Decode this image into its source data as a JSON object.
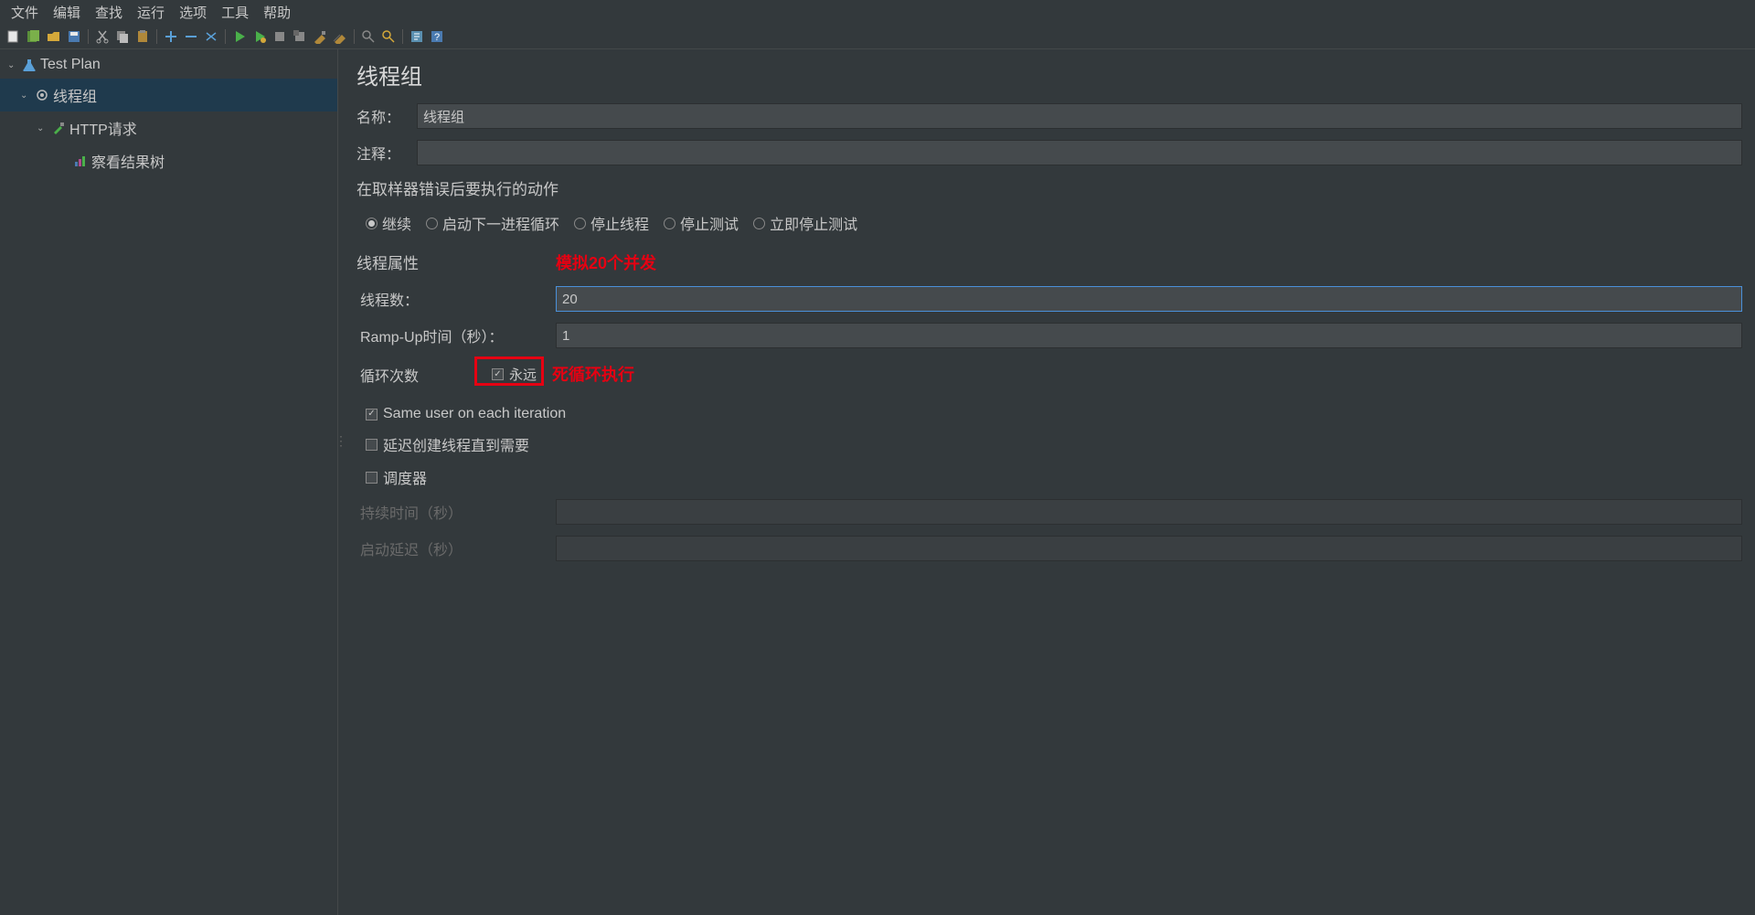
{
  "menubar": {
    "file": "文件",
    "edit": "编辑",
    "search": "查找",
    "run": "运行",
    "options": "选项",
    "tools": "工具",
    "help": "帮助"
  },
  "tree": {
    "test_plan": "Test Plan",
    "thread_group": "线程组",
    "http_request": "HTTP请求",
    "view_results": "察看结果树"
  },
  "panel": {
    "title": "线程组",
    "name_label": "名称：",
    "name_value": "线程组",
    "comment_label": "注释：",
    "comment_value": "",
    "on_error_title": "在取样器错误后要执行的动作",
    "radio_continue": "继续",
    "radio_next_loop": "启动下一进程循环",
    "radio_stop_thread": "停止线程",
    "radio_stop_test": "停止测试",
    "radio_stop_now": "立即停止测试",
    "thread_props_title": "线程属性",
    "threads_label": "线程数：",
    "threads_value": "20",
    "rampup_label": "Ramp-Up时间（秒）：",
    "rampup_value": "1",
    "loop_label": "循环次数",
    "forever_label": "永远",
    "same_user_label": "Same user on each iteration",
    "delay_create_label": "延迟创建线程直到需要",
    "scheduler_label": "调度器",
    "duration_label": "持续时间（秒）",
    "startup_delay_label": "启动延迟（秒）"
  },
  "annotations": {
    "concurrent": "模拟20个并发",
    "loop_forever": "死循环执行"
  }
}
